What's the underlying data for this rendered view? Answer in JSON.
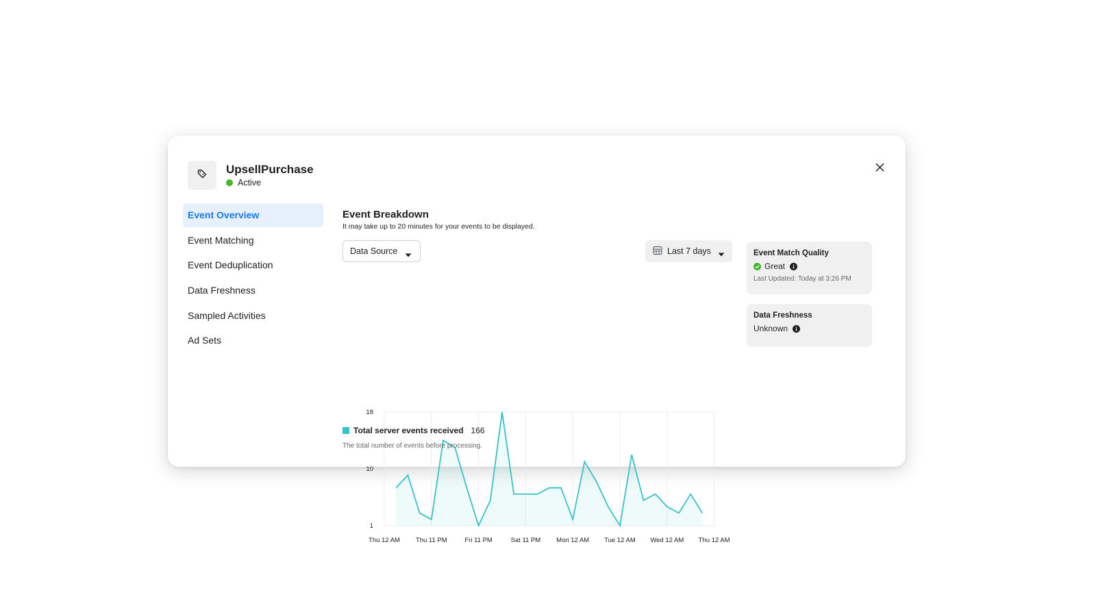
{
  "event": {
    "name": "UpsellPurchase",
    "status": "Active",
    "status_color": "#42b72a",
    "icon": "tag-icon"
  },
  "sidebar": {
    "items": [
      {
        "label": "Event Overview",
        "active": true
      },
      {
        "label": "Event Matching",
        "active": false
      },
      {
        "label": "Event Deduplication",
        "active": false
      },
      {
        "label": "Data Freshness",
        "active": false
      },
      {
        "label": "Sampled Activities",
        "active": false
      },
      {
        "label": "Ad Sets",
        "active": false
      }
    ]
  },
  "breakdown": {
    "title": "Event Breakdown",
    "subtitle": "It may take up to 20 minutes for your events to be displayed.",
    "data_source_label": "Data Source",
    "range_label": "Last 7 days"
  },
  "cards": {
    "emq": {
      "title": "Event Match Quality",
      "value": "Great",
      "updated": "Last Updated: Today at 3:26 PM"
    },
    "freshness": {
      "title": "Data Freshness",
      "value": "Unknown"
    }
  },
  "legend": {
    "label": "Total server events received",
    "value": "166",
    "description": "The total number of events before processing.",
    "color": "#35c2c9"
  },
  "chart_data": {
    "type": "area",
    "title": "",
    "xlabel": "",
    "ylabel": "",
    "x_tick_labels": [
      "Thu 12 AM",
      "Thu 11 PM",
      "Fri 11 PM",
      "Sat 11 PM",
      "Mon 12 AM",
      "Tue 12 AM",
      "Wed 12 AM",
      "Thu 12 AM"
    ],
    "y_tick_labels": [
      "1",
      "10",
      "18"
    ],
    "y_ticks": [
      1,
      10,
      18
    ],
    "ylim": [
      1,
      18
    ],
    "grid": true,
    "series": [
      {
        "name": "Total server events received",
        "color": "#35c2c9",
        "x_start_interval": 0.25,
        "x_step_interval": 0.25,
        "values": [
          7,
          9,
          3,
          2,
          14,
          13,
          7,
          1,
          5,
          18,
          6,
          6,
          6,
          7,
          7,
          2,
          11,
          8,
          4,
          1,
          12,
          5,
          6,
          4,
          3,
          6,
          3
        ]
      }
    ]
  }
}
